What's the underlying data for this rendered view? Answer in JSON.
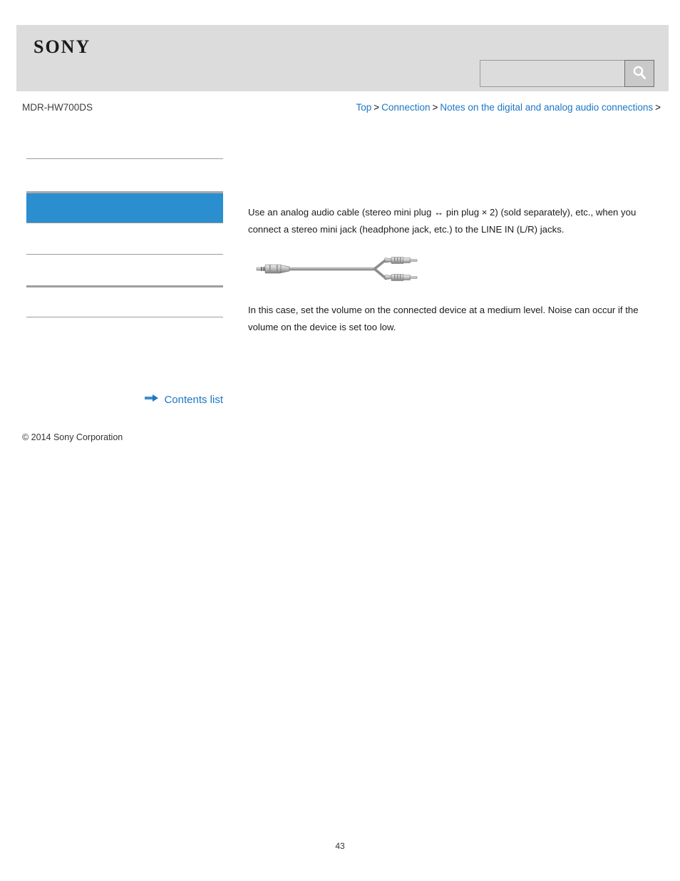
{
  "header": {
    "logo_text": "SONY",
    "logo_icon": "sony-wordmark",
    "search": {
      "value": "",
      "placeholder": "",
      "button_icon": "search-magnifier-icon"
    }
  },
  "breadcrumb": {
    "model": "MDR-HW700DS",
    "items": [
      {
        "label": "Top"
      },
      {
        "label": "Connection"
      },
      {
        "label": "Notes on the digital and analog audio connections"
      }
    ],
    "separator": ">",
    "trailing_separator": ">"
  },
  "sidebar": {
    "items": [
      {
        "label": "",
        "selected": false
      },
      {
        "label": "",
        "selected": true
      },
      {
        "label": "",
        "selected": false
      },
      {
        "label": "",
        "selected": false
      },
      {
        "label": "",
        "selected": false
      },
      {
        "label": "",
        "selected": false
      }
    ],
    "contents_list": {
      "label": "Contents list",
      "icon": "arrow-right-icon"
    }
  },
  "main": {
    "paragraph_1": "Use an analog audio cable (stereo mini plug ↔ pin plug × 2) (sold separately), etc., when you connect a stereo mini jack (headphone jack, etc.) to the LINE IN (L/R) jacks.",
    "figure": {
      "name": "analog-audio-cable-illustration",
      "description": "Stereo mini plug to two RCA pin plugs cable"
    },
    "paragraph_2": "In this case, set the volume on the connected device at a medium level. Noise can occur if the volume on the device is set too low."
  },
  "footer": {
    "copyright": "© 2014 Sony Corporation",
    "page_number": "43"
  },
  "colors": {
    "header_bg": "#dcdcdc",
    "link_blue": "#1c76c4",
    "selected_blue": "#2a8ecf",
    "rule_gray": "#9d9d9d"
  }
}
